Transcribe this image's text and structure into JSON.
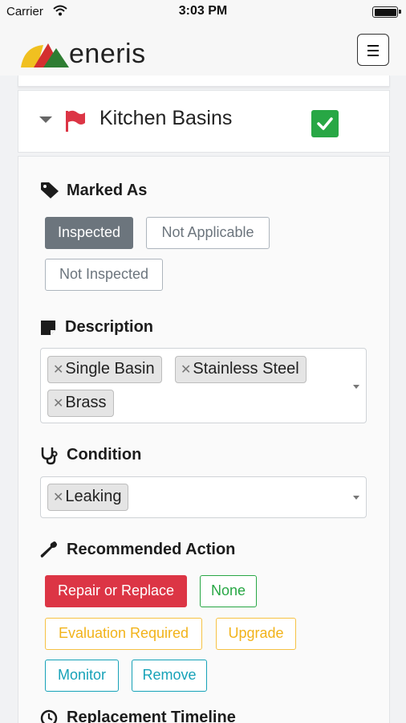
{
  "status_bar": {
    "carrier": "Carrier",
    "time": "3:03 PM"
  },
  "navbar": {
    "logo_text": "eneris"
  },
  "item": {
    "title": "Kitchen Basins",
    "checked": true
  },
  "marked_as": {
    "title": "Marked As",
    "options": [
      {
        "label": "Inspected",
        "selected": true
      },
      {
        "label": "Not Applicable",
        "selected": false
      },
      {
        "label": "Not Inspected",
        "selected": false
      }
    ]
  },
  "description": {
    "title": "Description",
    "tags": [
      "Single Basin",
      "Stainless Steel",
      "Brass"
    ]
  },
  "condition": {
    "title": "Condition",
    "tags": [
      "Leaking"
    ]
  },
  "recommended_action": {
    "title": "Recommended Action",
    "options": [
      {
        "label": "Repair or Replace",
        "selected": true,
        "color": "#dc3545"
      },
      {
        "label": "None",
        "selected": false,
        "color": "#28a745"
      },
      {
        "label": "Evaluation Required",
        "selected": false,
        "color": "#f2b31a"
      },
      {
        "label": "Upgrade",
        "selected": false,
        "color": "#f2b31a"
      },
      {
        "label": "Monitor",
        "selected": false,
        "color": "#17a2b8"
      },
      {
        "label": "Remove",
        "selected": false,
        "color": "#17a2b8"
      }
    ]
  },
  "replacement_timeline": {
    "title": "Replacement Timeline"
  },
  "icons": {
    "wifi": "wifi-icon",
    "battery": "battery-icon",
    "menu": "hamburger-menu-icon",
    "caret": "caret-down-icon",
    "flag": "flag-icon",
    "check": "checkmark-icon",
    "tag": "tag-icon",
    "description": "sticky-note-icon",
    "condition": "stethoscope-icon",
    "action": "wrench-icon",
    "timeline": "clock-icon",
    "remove_tag": "close-x-icon",
    "dropdown": "dropdown-arrow-icon"
  },
  "colors": {
    "inspected_bg": "#6c757d",
    "flag": "#dc3545",
    "check_bg": "#28a745",
    "logo_red": "#d32f2f",
    "logo_green": "#2e7d32",
    "logo_yellow": "#f0c020"
  }
}
